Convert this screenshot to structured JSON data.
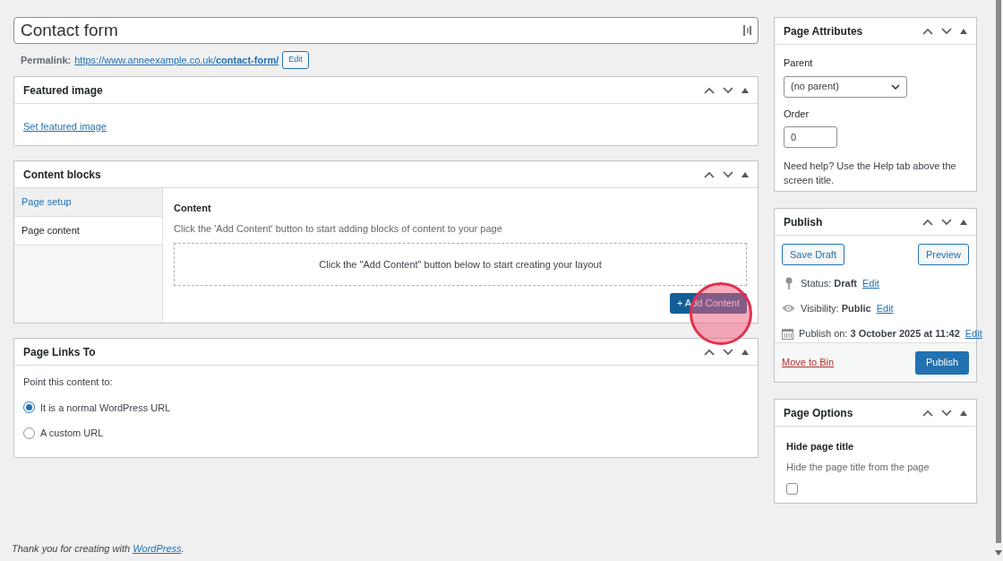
{
  "title_field": {
    "value": "Contact form"
  },
  "permalink": {
    "label": "Permalink:",
    "url": "https://www.anneexample.co.uk/**contact-form/**",
    "edit_button": "Edit"
  },
  "featured_image": {
    "title": "Featured image",
    "link": "Set featured image"
  },
  "content_blocks": {
    "title": "Content blocks",
    "tabs": [
      {
        "label": "Page setup",
        "selected": false
      },
      {
        "label": "Page content",
        "selected": true
      }
    ],
    "heading": "Content",
    "description": "Click the 'Add Content' button to start adding blocks of content to your page",
    "placeholder_text": "Click the \"Add Content\" button below to start creating your layout",
    "add_button": "+ Add Content",
    "click_highlight": true
  },
  "page_links_to": {
    "title": "Page Links To",
    "prompt": "Point this content to:",
    "options": [
      {
        "label": "It is a normal WordPress URL",
        "selected": true
      },
      {
        "label": "A custom URL",
        "selected": false
      }
    ]
  },
  "footer": {
    "text": "Thank you for creating with ",
    "link": "WordPress",
    "end": "."
  },
  "page_attributes": {
    "title": "Page Attributes",
    "parent_label": "Parent",
    "parent_value": "(no parent)",
    "order_label": "Order",
    "order_value": "0",
    "help": "Need help? Use the Help tab above the screen title."
  },
  "publish": {
    "title": "Publish",
    "save_draft": "Save Draft",
    "preview": "Preview",
    "rows": [
      {
        "kind": "status",
        "text": "Status: **Draft**",
        "link": "Edit"
      },
      {
        "kind": "visibility",
        "text": "Visibility: **Public**",
        "link": "Edit"
      },
      {
        "kind": "schedule",
        "text": "Publish on: **3 October 2025 at 11:42**",
        "link": "Edit"
      }
    ],
    "trash": "Move to Bin",
    "publish_button": "Publish"
  },
  "page_options": {
    "title": "Page Options",
    "heading": "Hide page title",
    "description": "Hide the page title from the page",
    "checked": false
  }
}
